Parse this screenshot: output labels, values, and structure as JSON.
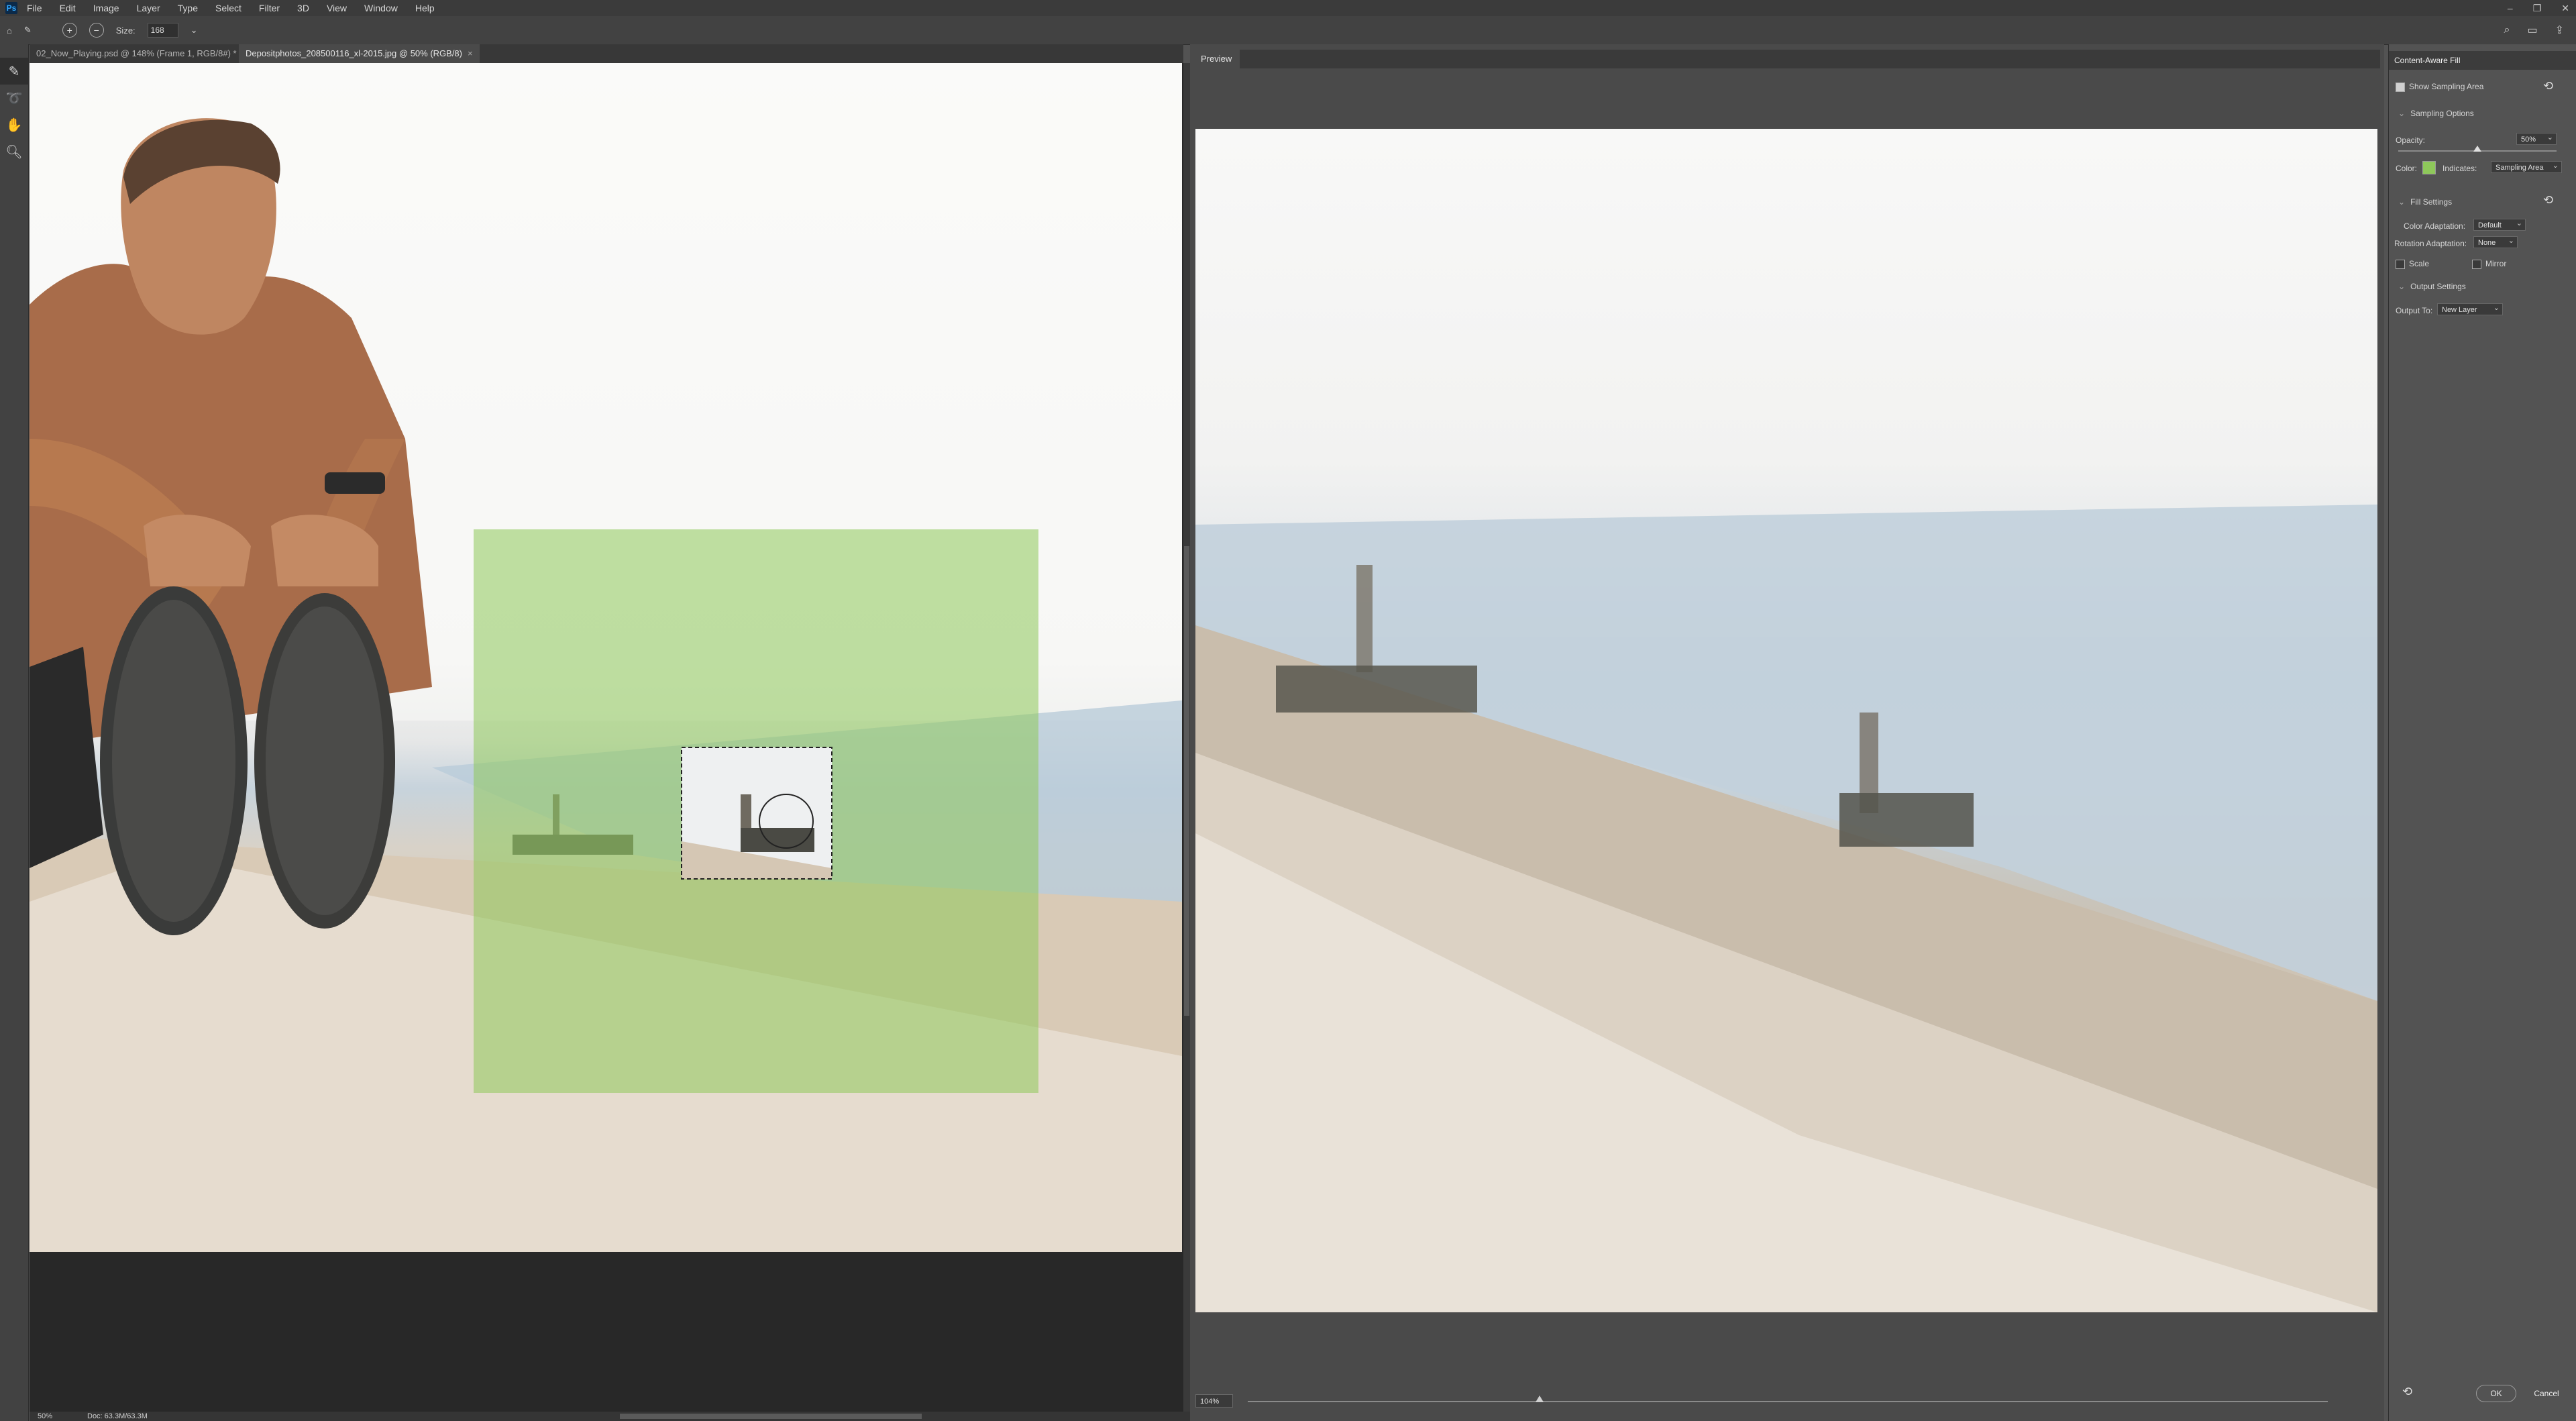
{
  "app": {
    "logo": "Ps"
  },
  "menu": [
    "File",
    "Edit",
    "Image",
    "Layer",
    "Type",
    "Select",
    "Filter",
    "3D",
    "View",
    "Window",
    "Help"
  ],
  "window_controls": [
    "–",
    "❐",
    "✕"
  ],
  "options_bar": {
    "size_label": "Size:",
    "size_value": "168"
  },
  "tabs": [
    {
      "label": "02_Now_Playing.psd @ 148% (Frame 1, RGB/8#) *",
      "active": false
    },
    {
      "label": "Depositphotos_208500116_xl-2015.jpg @ 50% (RGB/8)",
      "active": true
    }
  ],
  "status": {
    "zoom": "50%",
    "doc": "Doc: 63.3M/63.3M"
  },
  "preview": {
    "title": "Preview",
    "zoom": "104%",
    "zoom_level": 0.27
  },
  "panel": {
    "title": "Content-Aware Fill",
    "show_sampling_area": "Show Sampling Area",
    "sampling_options": "Sampling Options",
    "opacity_label": "Opacity:",
    "opacity_value": "50%",
    "opacity_level": 0.5,
    "color_label": "Color:",
    "sampling_color": "#8ec85a",
    "indicates_label": "Indicates:",
    "indicates_value": "Sampling Area",
    "fill_settings": "Fill Settings",
    "color_adaptation_label": "Color Adaptation:",
    "color_adaptation_value": "Default",
    "rotation_adaptation_label": "Rotation Adaptation:",
    "rotation_adaptation_value": "None",
    "scale_label": "Scale",
    "mirror_label": "Mirror",
    "output_settings": "Output Settings",
    "output_to_label": "Output To:",
    "output_to_value": "New Layer",
    "ok_label": "OK",
    "cancel_label": "Cancel"
  }
}
